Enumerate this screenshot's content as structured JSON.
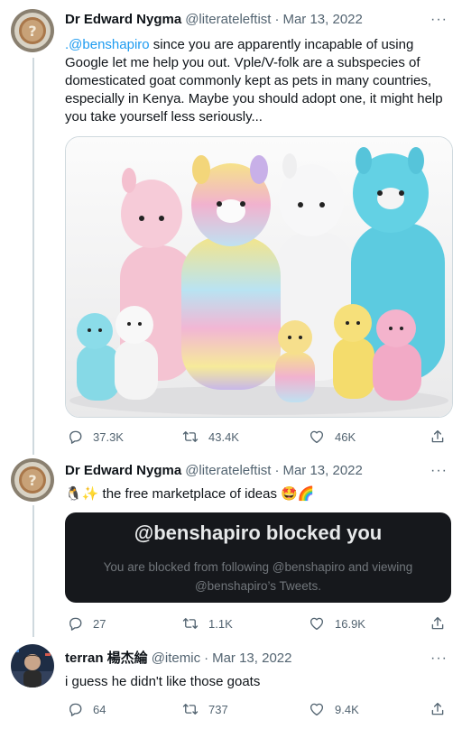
{
  "tweets": [
    {
      "name": "Dr Edward Nygma",
      "handle": "@literateleftist",
      "date": "Mar 13, 2022",
      "text_mention": ".@benshapiro",
      "text_rest": " since you are apparently incapable of using Google let me help you out. Vple/V-folk are a subspecies of domesticated goat commonly kept as pets in many countries, especially in Kenya. Maybe you should adopt one, it might help you take yourself less seriously...",
      "replies": "37.3K",
      "retweets": "43.4K",
      "likes": "46K"
    },
    {
      "name": "Dr Edward Nygma",
      "handle": "@literateleftist",
      "date": "Mar 13, 2022",
      "text_lead": "🐧✨",
      "text": " the free marketplace of ideas ",
      "text_trail": "🤩🌈",
      "blocked_title": "@benshapiro blocked you",
      "blocked_body": "You are blocked from following @benshapiro and viewing @benshapiro’s Tweets.",
      "replies": "27",
      "retweets": "1.1K",
      "likes": "16.9K"
    },
    {
      "name": "terran 楊杰綸",
      "handle": "@itemic",
      "date": "Mar 13, 2022",
      "text": "i guess he didn't like those goats",
      "replies": "64",
      "retweets": "737",
      "likes": "9.4K"
    }
  ],
  "meta_separator": "·",
  "more_glyph": "···",
  "colors": {
    "link": "#1d9bf0",
    "secondary": "#536471",
    "thread_line": "#cfd9de",
    "blocked_bg": "#16181c"
  },
  "icons": [
    "reply-icon",
    "retweet-icon",
    "like-icon",
    "share-icon",
    "more-icon"
  ]
}
